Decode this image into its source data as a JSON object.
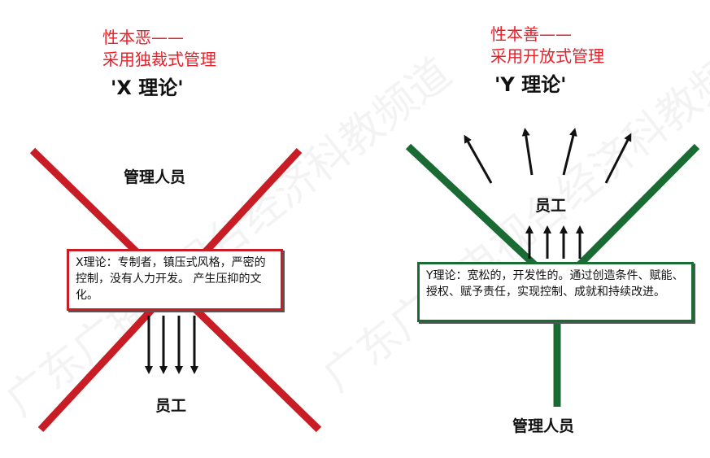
{
  "left": {
    "caption_line1": "性本恶——",
    "caption_line2": "采用独裁式管理",
    "title": "'X 理论'",
    "top_label": "管理人员",
    "box_text": "X理论：专制者，镇压式风格，严密的控制，没有人力开发。 产生压抑的文化。",
    "bottom_label": "员工",
    "line_color": "#c81d25"
  },
  "right": {
    "caption_line1": "性本善——",
    "caption_line2": "采用开放式管理",
    "title": "'Y 理论'",
    "top_label": "员工",
    "box_text": "Y理论：宽松的，开发性的。通过创造条件、赋能、授权、赋予责任，实现控制、成就和持续改进。",
    "bottom_label": "管理人员",
    "line_color": "#1a6b33"
  },
  "watermark": "广东广播电视台经济科教频道"
}
